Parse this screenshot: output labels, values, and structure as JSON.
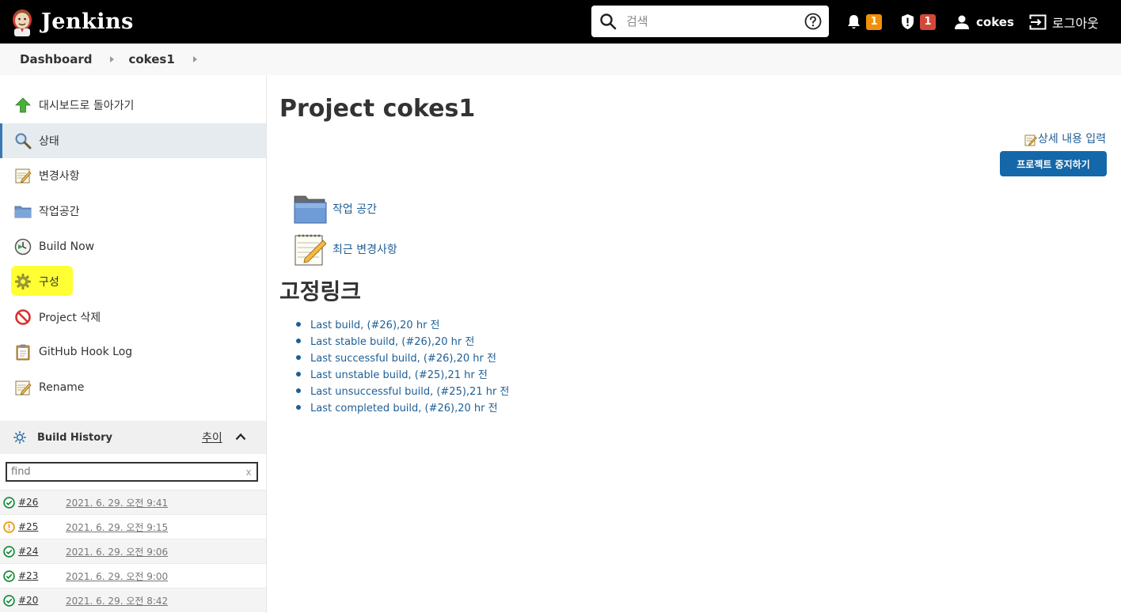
{
  "header": {
    "app_name": "Jenkins",
    "search_placeholder": "검색",
    "notifications_count": "1",
    "security_count": "1",
    "user_name": "cokes",
    "logout_label": "로그아웃",
    "colors": {
      "bar": "#000000",
      "notification_badge": "#f0900a",
      "security_badge": "#d24939"
    }
  },
  "breadcrumb": {
    "items": [
      "Dashboard",
      "cokes1"
    ]
  },
  "sidebar": {
    "tasks": [
      {
        "label": "대시보드로 돌아가기",
        "icon": "up-arrow-icon"
      },
      {
        "label": "상태",
        "icon": "magnifier-icon"
      },
      {
        "label": "변경사항",
        "icon": "notepad-icon"
      },
      {
        "label": "작업공간",
        "icon": "folder-icon"
      },
      {
        "label": "Build Now",
        "icon": "clock-play-icon"
      },
      {
        "label": "구성",
        "icon": "gear-icon"
      },
      {
        "label": "Project 삭제",
        "icon": "no-entry-icon"
      },
      {
        "label": "GitHub Hook Log",
        "icon": "clipboard-icon"
      },
      {
        "label": "Rename",
        "icon": "notepad-icon"
      }
    ],
    "build_history": {
      "title": "Build History",
      "trend_label": "추이",
      "find_placeholder": "find",
      "clear_label": "x",
      "builds": [
        {
          "number": "#26",
          "date": "2021. 6. 29. 오전 9:41",
          "status": "success"
        },
        {
          "number": "#25",
          "date": "2021. 6. 29. 오전 9:15",
          "status": "unstable"
        },
        {
          "number": "#24",
          "date": "2021. 6. 29. 오전 9:06",
          "status": "success"
        },
        {
          "number": "#23",
          "date": "2021. 6. 29. 오전 9:00",
          "status": "success"
        },
        {
          "number": "#20",
          "date": "2021. 6. 29. 오전 8:42",
          "status": "success"
        }
      ]
    }
  },
  "main": {
    "title": "Project cokes1",
    "edit_description_label": "상세 내용 입력",
    "disable_button_label": "프로젝트 중지하기",
    "links": [
      {
        "label": "작업 공간",
        "icon": "folder-icon"
      },
      {
        "label": "최근 변경사항",
        "icon": "notepad-icon"
      }
    ],
    "permalinks_title": "고정링크",
    "permalinks": [
      "Last build, (#26),20 hr 전",
      "Last stable build, (#26),20 hr 전",
      "Last successful build, (#26),20 hr 전",
      "Last unstable build, (#25),21 hr 전",
      "Last unsuccessful build, (#25),21 hr 전",
      "Last completed build, (#26),20 hr 전"
    ]
  }
}
